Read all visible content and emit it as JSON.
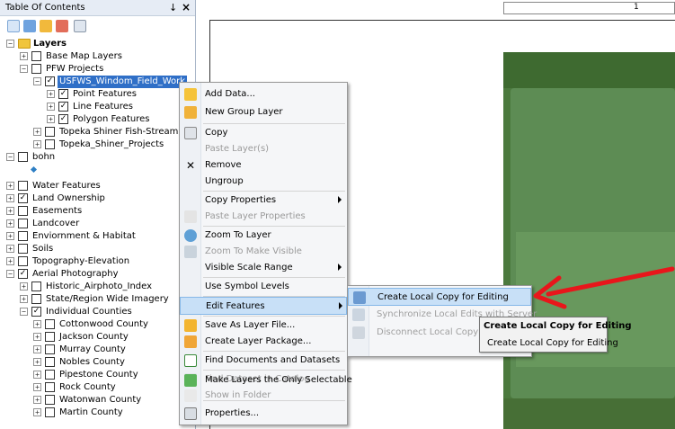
{
  "toc": {
    "title": "Table Of Contents",
    "pin_glyph": "↓",
    "close_glyph": "×",
    "tree": {
      "layers": "Layers",
      "base_map": "Base Map Layers",
      "pfw_projects": "PFW Projects",
      "usfws": "USFWS_Windom_Field_Work",
      "point": "Point Features",
      "line": "Line Features",
      "polygon": "Polygon Features",
      "topeka_fish": "Topeka Shiner Fish-Stream S",
      "topeka_proj": "Topeka_Shiner_Projects",
      "bohn": "bohn",
      "water": "Water Features",
      "land_own": "Land Ownership",
      "easements": "Easements",
      "landcover": "Landcover",
      "environment": "Enviornment & Habitat",
      "soils": "Soils",
      "topo": "Topography-Elevation",
      "aerial": "Aerial Photography",
      "historic": "Historic_Airphoto_Index",
      "state_region": "State/Region Wide Imagery",
      "individual": "Individual Counties",
      "cottonwood": "Cottonwood County",
      "jackson": "Jackson County",
      "murray": "Murray County",
      "nobles": "Nobles County",
      "pipestone": "Pipestone County",
      "rock": "Rock County",
      "watonwan": "Watonwan County",
      "martin": "Martin County"
    }
  },
  "map": {
    "ruler_label": "1"
  },
  "context_menu": {
    "add_data": "Add Data...",
    "new_group": "New Group Layer",
    "copy": "Copy",
    "paste_layers": "Paste Layer(s)",
    "remove": "Remove",
    "ungroup": "Ungroup",
    "copy_props": "Copy Properties",
    "paste_props": "Paste Layer Properties",
    "zoom_layer": "Zoom To Layer",
    "zoom_visible": "Zoom To Make Visible",
    "visible_scale": "Visible Scale Range",
    "symbol_levels": "Use Symbol Levels",
    "edit_features": "Edit Features",
    "save_layer_file": "Save As Layer File...",
    "create_package": "Create Layer Package...",
    "find_docs": "Find Documents and Datasets",
    "find_dataset": "Find Dataset in Catalog",
    "show_folder": "Show in Folder",
    "make_selectable": "Make Layers the Only Selectable",
    "properties": "Properties..."
  },
  "submenu": {
    "create_local": "Create Local Copy for Editing",
    "sync": "Synchronize Local Edits with Server",
    "disconnect": "Disconnect Local Copy from"
  },
  "tooltip": {
    "title": "Create Local Copy for Editing",
    "desc": "Create Local Copy for Editing"
  },
  "colors": {
    "selection": "#2f6fc7",
    "highlight": "#c8e0f7",
    "annotation_arrow": "#e8161b"
  }
}
